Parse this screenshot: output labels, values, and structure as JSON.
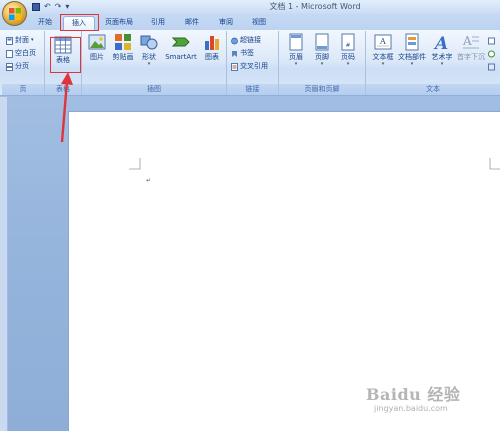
{
  "window": {
    "title": "文档 1 - Microsoft Word"
  },
  "quick_access": {
    "undo_label": "↶",
    "redo_label": "↷",
    "more_label": "▾"
  },
  "tabs": [
    {
      "label": "开始",
      "active": false
    },
    {
      "label": "插入",
      "active": true
    },
    {
      "label": "页面布局",
      "active": false
    },
    {
      "label": "引用",
      "active": false
    },
    {
      "label": "邮件",
      "active": false
    },
    {
      "label": "审阅",
      "active": false
    },
    {
      "label": "视图",
      "active": false
    }
  ],
  "ribbon": {
    "pages_group": {
      "label": "页",
      "cover_page": "封面",
      "blank_page": "空白页",
      "page_break": "分页"
    },
    "tables_group": {
      "label": "表格",
      "table_button": "表格"
    },
    "illustrations_group": {
      "label": "插图",
      "picture": "图片",
      "clip_art": "剪贴画",
      "shapes": "形状",
      "smartart": "SmartArt",
      "chart": "图表"
    },
    "links_group": {
      "label": "链接",
      "hyperlink": "超链接",
      "bookmark": "书签",
      "cross_reference": "交叉引用"
    },
    "header_footer_group": {
      "label": "页眉和页脚",
      "header": "页眉",
      "footer": "页脚",
      "page_number": "页码"
    },
    "text_group": {
      "label": "文本",
      "text_box": "文本框",
      "quick_parts": "文档部件",
      "wordart": "艺术字",
      "drop_cap": "首字下沉"
    }
  },
  "document": {
    "paragraph_mark": "↵"
  },
  "watermark": {
    "brand": "Baidu 经验",
    "url": "jingyan.baidu.com"
  },
  "colors": {
    "highlight": "#e0343b",
    "ribbon_text": "#15428b"
  }
}
